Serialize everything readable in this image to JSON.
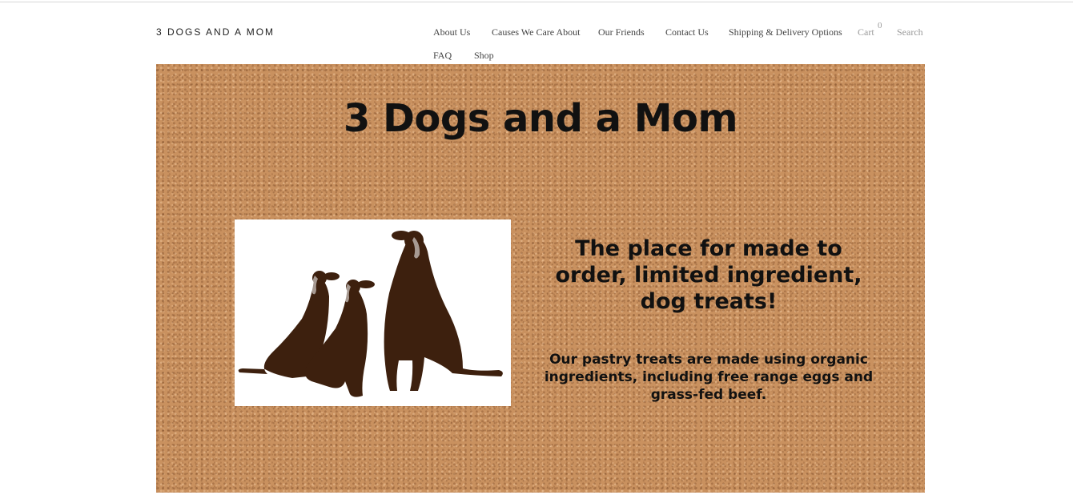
{
  "site": {
    "title": "3 DOGS AND A MOM"
  },
  "nav": {
    "items": [
      {
        "label": "About Us"
      },
      {
        "label": "Causes We Care About"
      },
      {
        "label": "Our Friends"
      },
      {
        "label": "Contact Us"
      },
      {
        "label": "Shipping & Delivery Options"
      },
      {
        "label": "FAQ"
      },
      {
        "label": "Shop"
      }
    ],
    "cart_label": "Cart",
    "cart_count": "0",
    "search_label": "Search"
  },
  "banner": {
    "title": "3 Dogs and a Mom",
    "tagline": "The place for made to order, limited ingredient, dog treats!",
    "subtext": "Our pastry treats are made using organic ingredients, including free range eggs and grass-fed beef.",
    "background_color": "#c9915f",
    "dog_color": "#3d200e"
  }
}
